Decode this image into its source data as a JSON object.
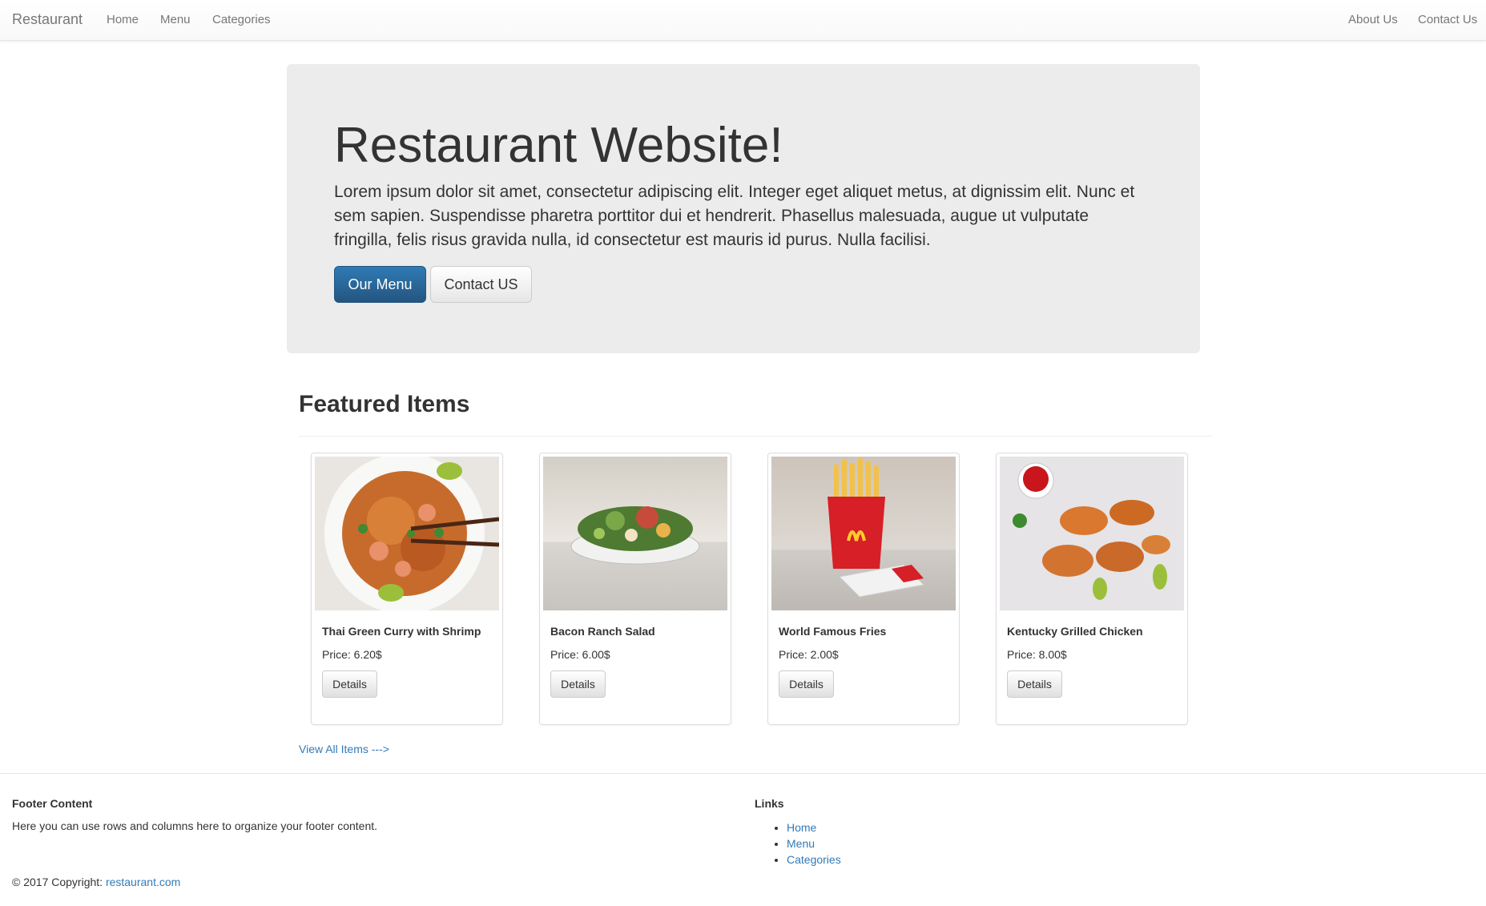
{
  "navbar": {
    "brand": "Restaurant",
    "left_links": [
      "Home",
      "Menu",
      "Categories"
    ],
    "right_links": [
      "About Us",
      "Contact Us"
    ]
  },
  "jumbotron": {
    "title": "Restaurant Website!",
    "lead": "Lorem ipsum dolor sit amet, consectetur adipiscing elit. Integer eget aliquet metus, at dignissim elit. Nunc et sem sapien. Suspendisse pharetra porttitor dui et hendrerit. Phasellus malesuada, augue ut vulputate fringilla, felis risus gravida nulla, id consectetur est mauris id purus. Nulla facilisi.",
    "primary_button": "Our Menu",
    "secondary_button": "Contact US"
  },
  "featured": {
    "title": "Featured Items",
    "items": [
      {
        "name": "Thai Green Curry with Shrimp",
        "price": "Price: 6.20$",
        "button": "Details",
        "image": "noodle-bowl-image"
      },
      {
        "name": "Bacon Ranch Salad",
        "price": "Price: 6.00$",
        "button": "Details",
        "image": "salad-bowl-image"
      },
      {
        "name": "World Famous Fries",
        "price": "Price: 2.00$",
        "button": "Details",
        "image": "fries-image"
      },
      {
        "name": "Kentucky Grilled Chicken",
        "price": "Price: 8.00$",
        "button": "Details",
        "image": "fried-chicken-image"
      }
    ],
    "view_all": "View All Items --->"
  },
  "footer": {
    "content_heading": "Footer Content",
    "content_text": "Here you can use rows and columns here to organize your footer content.",
    "links_heading": "Links",
    "links": [
      "Home",
      "Menu",
      "Categories"
    ],
    "copyright_prefix": "© 2017 Copyright: ",
    "copyright_link": "restaurant.com"
  },
  "colors": {
    "primary": "#337ab7",
    "jumbotron_bg": "#ececec",
    "nav_text": "#777777"
  }
}
